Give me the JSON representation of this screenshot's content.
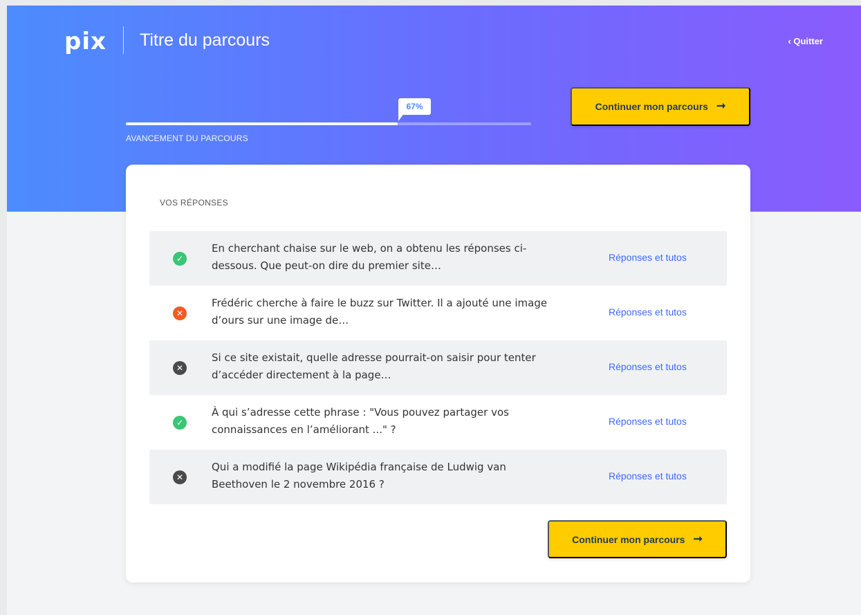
{
  "header": {
    "logo": "pix",
    "course_title": "Titre du parcours",
    "quit_label": "‹ Quitter"
  },
  "progress": {
    "percent_label": "67%",
    "value": 0.67,
    "label": "AVANCEMENT DU PARCOURS"
  },
  "continue_button": {
    "label": "Continuer mon parcours",
    "icon": "arrow-right-icon"
  },
  "answers_section": {
    "title": "VOS RÉPONSES",
    "items": [
      {
        "status": "ok",
        "status_icon": "check-circle-icon",
        "status_color": "#3bc574",
        "question": "En cherchant chaise sur le web, on a obtenu les réponses ci-dessous. Que peut-on dire du premier site…",
        "link_label": "Réponses et tutos"
      },
      {
        "status": "ko",
        "status_icon": "cross-circle-icon",
        "status_color": "#f15b23",
        "question": "Frédéric cherche à faire le buzz sur Twitter. Il a ajouté une image d’ours sur une image de…",
        "link_label": "Réponses et tutos"
      },
      {
        "status": "skipped",
        "status_icon": "cross-circle-icon",
        "status_color": "#4a4a4a",
        "question": "Si ce site existait, quelle adresse pourrait-on saisir pour tenter d’accéder directement à la page…",
        "link_label": "Réponses et tutos"
      },
      {
        "status": "ok",
        "status_icon": "check-circle-icon",
        "status_color": "#3bc574",
        "question": "À qui s’adresse cette phrase : \"Vous pouvez partager vos connaissances en l’améliorant ...\" ?",
        "link_label": "Réponses et tutos"
      },
      {
        "status": "skipped",
        "status_icon": "cross-circle-icon",
        "status_color": "#4a4a4a",
        "question": "Qui a modifié la page Wikipédia française de Ludwig van Beethoven le 2 novembre 2016 ?",
        "link_label": "Réponses et tutos"
      }
    ]
  },
  "colors": {
    "header_gradient_start": "#4c8cfe",
    "header_gradient_end": "#8a5cfd",
    "button": "#ffcc00",
    "link": "#3d68ff"
  }
}
